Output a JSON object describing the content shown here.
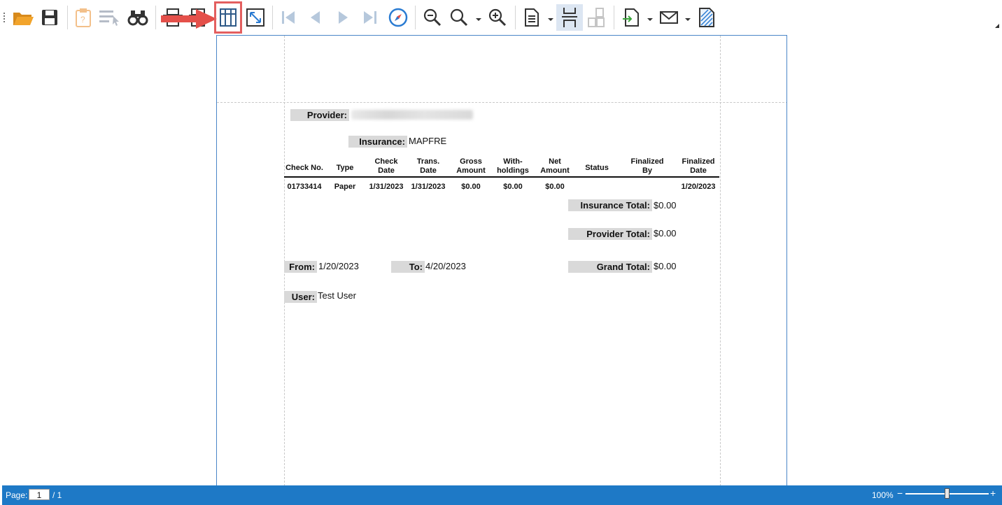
{
  "toolbar": {
    "buttons": [
      {
        "name": "open-icon"
      },
      {
        "name": "save-icon"
      },
      {
        "name": "clipboard-icon"
      },
      {
        "name": "select-tool-icon"
      },
      {
        "name": "find-binoculars-icon"
      },
      {
        "name": "print-icon"
      },
      {
        "name": "page-setup-icon"
      },
      {
        "name": "margins-grid-icon"
      },
      {
        "name": "fit-page-icon"
      },
      {
        "name": "first-page-icon"
      },
      {
        "name": "previous-page-icon"
      },
      {
        "name": "next-page-icon"
      },
      {
        "name": "last-page-icon"
      },
      {
        "name": "navigate-compass-icon"
      },
      {
        "name": "zoom-out-icon"
      },
      {
        "name": "zoom-icon"
      },
      {
        "name": "zoom-in-icon"
      },
      {
        "name": "document-icon"
      },
      {
        "name": "continuous-view-icon"
      },
      {
        "name": "multi-page-icon"
      },
      {
        "name": "export-icon"
      },
      {
        "name": "email-icon"
      },
      {
        "name": "watermark-icon"
      }
    ]
  },
  "report": {
    "provider_label": "Provider:",
    "provider_value": "",
    "insurance_label": "Insurance:",
    "insurance_value": "MAPFRE",
    "columns": [
      "Check No.",
      "Type",
      "Check\nDate",
      "Trans.\nDate",
      "Gross\nAmount",
      "With-\nholdings",
      "Net\nAmount",
      "Status",
      "Finalized\nBy",
      "Finalized\nDate"
    ],
    "rows": [
      [
        "01733414",
        "Paper",
        "1/31/2023",
        "1/31/2023",
        "$0.00",
        "$0.00",
        "$0.00",
        "",
        "",
        "1/20/2023"
      ]
    ],
    "insurance_total_label": "Insurance Total:",
    "insurance_total_value": "$0.00",
    "provider_total_label": "Provider Total:",
    "provider_total_value": "$0.00",
    "from_label": "From:",
    "from_value": "1/20/2023",
    "to_label": "To:",
    "to_value": "4/20/2023",
    "grand_total_label": "Grand Total:",
    "grand_total_value": "$0.00",
    "user_label": "User:",
    "user_value": "Test User"
  },
  "statusbar": {
    "page_label": "Page:",
    "page_current": "1",
    "page_total": "/ 1",
    "zoom": "100%",
    "zoom_minus": "−",
    "zoom_plus": "+",
    "zoom_level": 0.5
  },
  "colors": {
    "accent": "#1e79c6",
    "highlight": "#e35f5f",
    "label_bg": "#d9d9d9",
    "page_border": "#4a86c8"
  }
}
